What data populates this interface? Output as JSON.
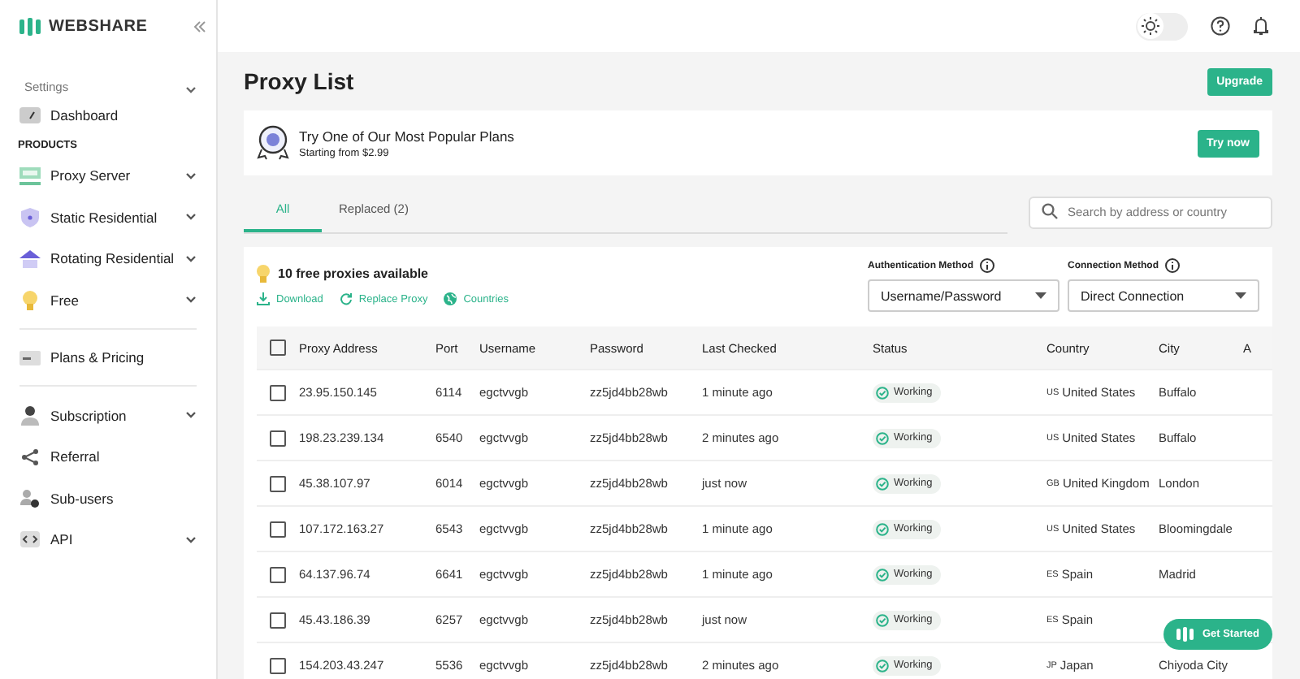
{
  "brand": {
    "name": "WEBSHARE"
  },
  "topbar": {
    "dark_mode": false
  },
  "sidebar": {
    "settings_label": "Settings",
    "items": [
      {
        "label": "Dashboard",
        "expandable": false,
        "divider_before": false
      },
      {
        "label": "Proxy Server",
        "expandable": true,
        "divider_before": false,
        "section": "PRODUCTS"
      },
      {
        "label": "Static Residential",
        "expandable": true,
        "divider_before": false
      },
      {
        "label": "Rotating Residential",
        "expandable": true,
        "divider_before": false
      },
      {
        "label": "Free",
        "expandable": true,
        "divider_before": false
      },
      {
        "label": "Plans & Pricing",
        "expandable": false,
        "divider_before": true
      },
      {
        "label": "Subscription",
        "expandable": true,
        "divider_before": true
      },
      {
        "label": "Referral",
        "expandable": false,
        "divider_before": false
      },
      {
        "label": "Sub-users",
        "expandable": false,
        "divider_before": false
      },
      {
        "label": "API",
        "expandable": true,
        "divider_before": false
      }
    ]
  },
  "page": {
    "title": "Proxy List",
    "upgrade_button": "Upgrade"
  },
  "promo": {
    "title": "Try One of Our Most Popular Plans",
    "subtitle": "Starting from $2.99",
    "button": "Try now"
  },
  "tabs": [
    {
      "label": "All",
      "selected": true
    },
    {
      "label": "Replaced (2)",
      "selected": false
    }
  ],
  "search": {
    "placeholder": "Search by address or country"
  },
  "panel": {
    "free_count": "10 free proxies available",
    "actions": [
      "Download",
      "Replace Proxy",
      "Countries"
    ],
    "auth": {
      "label": "Authentication Method",
      "value": "Username/Password"
    },
    "connection": {
      "label": "Connection Method",
      "value": "Direct Connection"
    }
  },
  "table": {
    "all_checked": false,
    "columns": [
      "Proxy Address",
      "Port",
      "Username",
      "Password",
      "Last Checked",
      "Status",
      "Country",
      "City",
      "A"
    ],
    "rows": [
      {
        "address": "23.95.150.145",
        "port": "6114",
        "username": "egctvvgb",
        "password": "zz5jd4bb28wb",
        "last_checked": "1 minute ago",
        "status": "Working",
        "flag": "US",
        "country": "United States",
        "city": "Buffalo",
        "checked": false
      },
      {
        "address": "198.23.239.134",
        "port": "6540",
        "username": "egctvvgb",
        "password": "zz5jd4bb28wb",
        "last_checked": "2 minutes ago",
        "status": "Working",
        "flag": "US",
        "country": "United States",
        "city": "Buffalo",
        "checked": false
      },
      {
        "address": "45.38.107.97",
        "port": "6014",
        "username": "egctvvgb",
        "password": "zz5jd4bb28wb",
        "last_checked": "just now",
        "status": "Working",
        "flag": "GB",
        "country": "United Kingdom",
        "city": "London",
        "checked": false
      },
      {
        "address": "107.172.163.27",
        "port": "6543",
        "username": "egctvvgb",
        "password": "zz5jd4bb28wb",
        "last_checked": "1 minute ago",
        "status": "Working",
        "flag": "US",
        "country": "United States",
        "city": "Bloomingdale",
        "checked": false
      },
      {
        "address": "64.137.96.74",
        "port": "6641",
        "username": "egctvvgb",
        "password": "zz5jd4bb28wb",
        "last_checked": "1 minute ago",
        "status": "Working",
        "flag": "ES",
        "country": "Spain",
        "city": "Madrid",
        "checked": false
      },
      {
        "address": "45.43.186.39",
        "port": "6257",
        "username": "egctvvgb",
        "password": "zz5jd4bb28wb",
        "last_checked": "just now",
        "status": "Working",
        "flag": "ES",
        "country": "Spain",
        "checked": false
      },
      {
        "address": "154.203.43.247",
        "port": "5536",
        "username": "egctvvgb",
        "password": "zz5jd4bb28wb",
        "last_checked": "2 minutes ago",
        "status": "Working",
        "flag": "JP",
        "country": "Japan",
        "city": "Chiyoda City",
        "checked": false
      }
    ]
  },
  "get_started": {
    "label": "Get Started"
  }
}
